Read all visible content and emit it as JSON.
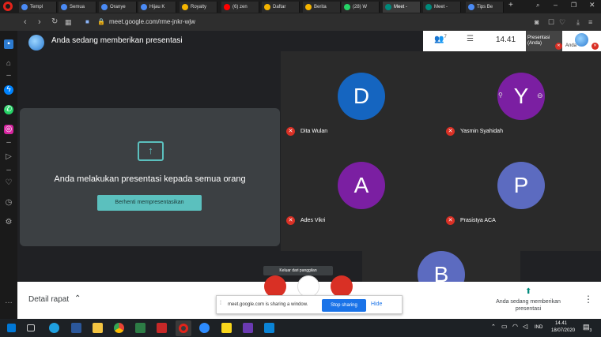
{
  "browser": {
    "tabs": [
      {
        "label": "Templ",
        "color": "#4a8af4"
      },
      {
        "label": "Semua",
        "color": "#4a8af4"
      },
      {
        "label": "Oranye",
        "color": "#4a8af4"
      },
      {
        "label": "Hijau K",
        "color": "#4a8af4"
      },
      {
        "label": "Royalty",
        "color": "#f4b400"
      },
      {
        "label": "(6) zen",
        "color": "#ff0000"
      },
      {
        "label": "Daftar",
        "color": "#f4b400"
      },
      {
        "label": "Berita",
        "color": "#f4b400"
      },
      {
        "label": "(28) W",
        "color": "#25d366"
      },
      {
        "label": "Meet -",
        "color": "#00897b"
      },
      {
        "label": "Meet -",
        "color": "#00897b"
      },
      {
        "label": "Tips Be",
        "color": "#4a8af4"
      }
    ],
    "url": "meet.google.com/rme-jnkr-wjw"
  },
  "meet": {
    "header_title": "Anda sedang memberikan presentasi",
    "time": "14.41",
    "self_tile_label": "Presentasi (Anda)",
    "self_label": "Anda",
    "participants_count": "7",
    "present_message": "Anda melakukan presentasi kepada semua orang",
    "stop_presenting_label": "Berhenti mempresentasikan",
    "leave_tooltip": "Keluar dari panggilan",
    "participants": [
      {
        "initial": "D",
        "name": "Dita Wulan",
        "color": "#1565c0"
      },
      {
        "initial": "Y",
        "name": "Yasmin Syahidah",
        "color": "#7b1fa2"
      },
      {
        "initial": "A",
        "name": "Ades Vikri",
        "color": "#7b1fa2"
      },
      {
        "initial": "P",
        "name": "Prasistya ACA",
        "color": "#5c6bc0"
      },
      {
        "initial": "B",
        "name": "",
        "color": "#5c6bc0"
      }
    ],
    "meeting_details_label": "Detail rapat",
    "presenting_status": "Anda sedang memberikan presentasi"
  },
  "sharing_bar": {
    "text": "meet.google.com is sharing a window.",
    "stop_label": "Stop sharing",
    "hide_label": "Hide"
  },
  "taskbar": {
    "language": "IND",
    "time": "14.41",
    "date": "18/07/2020",
    "notifications": "3"
  }
}
